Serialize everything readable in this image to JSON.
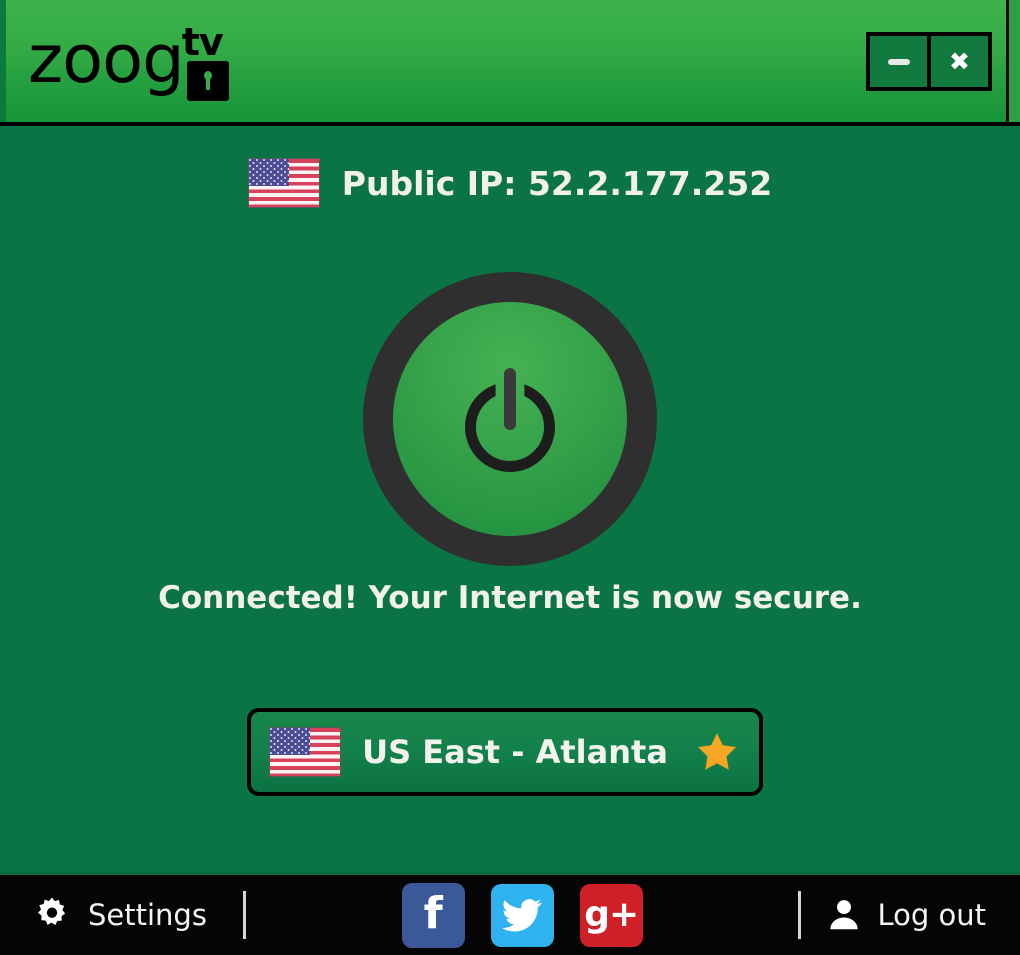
{
  "window": {
    "brand_name": "zoog",
    "brand_suffix": "tv",
    "logo_icon": "padlock-icon",
    "minimize_label": "—",
    "close_label": "✖"
  },
  "main": {
    "public_ip_label": "Public IP: 52.2.177.252",
    "public_ip_flag": "us-flag-icon",
    "power_state": "connected",
    "power_icon": "power-icon",
    "status_message": "Connected! Your Internet is now secure.",
    "server": {
      "flag": "us-flag-icon",
      "name": "US East - Atlanta",
      "favorite_icon": "star-icon",
      "favorite": true
    }
  },
  "footer": {
    "settings_label": "Settings",
    "settings_icon": "gear-icon",
    "social": [
      {
        "name": "facebook",
        "glyph": "f",
        "color": "#3b5998"
      },
      {
        "name": "twitter",
        "glyph": "bird",
        "color": "#2fb2ee"
      },
      {
        "name": "google-plus",
        "glyph": "g+",
        "color": "#cf2027"
      }
    ],
    "logout_label": "Log out",
    "logout_icon": "user-icon"
  },
  "colors": {
    "header_top": "#3cb44a",
    "header_bottom": "#17953a",
    "body_green": "#0a7445",
    "footer_black": "#050505",
    "star_gold": "#f5a623",
    "text_cream": "#f2f0ea"
  }
}
